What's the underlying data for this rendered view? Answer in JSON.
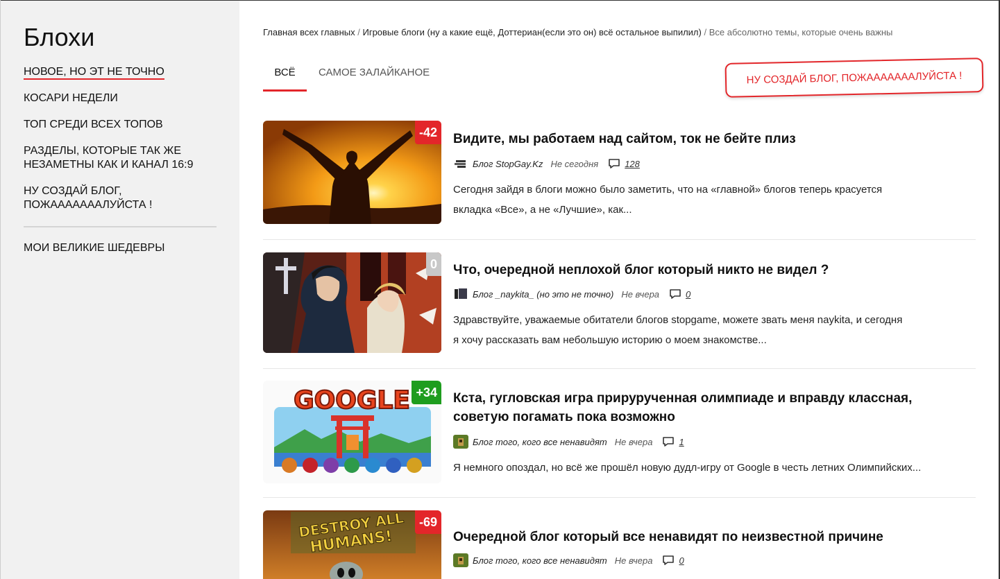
{
  "sidebar": {
    "title": "Блохи",
    "items": [
      {
        "label": "НОВОЕ, НО ЭТ НЕ ТОЧНО",
        "active": true
      },
      {
        "label": "КОСАРИ НЕДЕЛИ"
      },
      {
        "label": "ТОП СРЕДИ ВСЕХ ТОПОВ"
      },
      {
        "label": "РАЗДЕЛЫ, КОТОРЫЕ ТАК ЖЕ НЕЗАМЕТНЫ КАК И КАНАЛ 16:9"
      },
      {
        "label": "НУ СОЗДАЙ БЛОГ, ПОЖАААААААЛУЙСТА !"
      },
      {
        "label": "МОИ ВЕЛИКИЕ ШЕДЕВРЫ"
      }
    ]
  },
  "breadcrumb": {
    "items": [
      "Главная всех главных",
      "Игровые блоги (ну а какие ещё, Доттериан(если это он) всё остальное выпилил)",
      "Все абсолютно темы, которые очень важны"
    ],
    "separator": "/"
  },
  "tabs": [
    {
      "label": "ВСЁ",
      "active": true
    },
    {
      "label": "САМОЕ ЗАЛАЙКАНОЕ"
    }
  ],
  "create_button": {
    "label": "НУ СОЗДАЙ БЛОГ, ПОЖАААААААЛУЙСТА !"
  },
  "posts": [
    {
      "rating": "-42",
      "title": "Видите, мы работаем над сайтом, ток не бейте плиз",
      "blog": "Блог StopGay.Kz",
      "date": "Не сегодня",
      "comments": "128",
      "excerpt_lines": [
        "Сегодня зайдя в блоги можно было заметить, что на «главной» блогов теперь красуется",
        "вкладка «Все», а не «Лучшие», как..."
      ]
    },
    {
      "rating": "0",
      "title": "Что, очередной неплохой блог который никто не видел ?",
      "blog": "Блог _naykita_ (но это не точно)",
      "date": "Не вчера",
      "comments": "0",
      "excerpt_lines": [
        "Здравствуйте, уважаемые обитатели блогов stopgame, можете звать меня naykita, и сегодня",
        "я хочу рассказать вам небольшую историю о моем знакомстве..."
      ]
    },
    {
      "rating": "+34",
      "title_lines": [
        "Кста, гугловская игра прирурученная олимпиаде и вправду классная,",
        "советую погамать пока возможно"
      ],
      "blog": "Блог того, кого все ненавидят",
      "date": "Не вчера",
      "comments": "1",
      "excerpt_lines": [
        "Я немного опоздал, но всё же прошёл новую дудл-игру от Google в честь летних Олимпийских..."
      ],
      "image_text": "GOOGLE"
    },
    {
      "rating": "-69",
      "title": "Очередной блог который все ненавидят по неизвестной причине",
      "blog": "Блог того, кого все ненавидят",
      "date": "Не вчера",
      "comments": "0",
      "image_text_lines": [
        "DESTROY ALL",
        "HUMANS!"
      ]
    }
  ],
  "colors": {
    "accent": "#e3262a",
    "positive": "#1e9d1e",
    "neutral": "#c8c8c8",
    "sidebar_bg": "#f1f1f1"
  },
  "icons": [
    "comment-icon",
    "blog-avatar-icon"
  ]
}
